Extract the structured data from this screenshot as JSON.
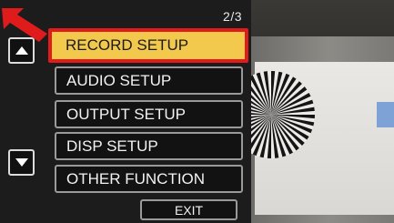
{
  "menu": {
    "page_indicator": "2/3",
    "items": [
      {
        "label": "RECORD SETUP",
        "selected": true
      },
      {
        "label": "AUDIO SETUP",
        "selected": false
      },
      {
        "label": "OUTPUT SETUP",
        "selected": false
      },
      {
        "label": "DISP SETUP",
        "selected": false
      },
      {
        "label": "OTHER FUNCTION",
        "selected": false
      }
    ],
    "exit_label": "EXIT",
    "scroll_up_icon": "up-arrow-icon",
    "scroll_down_icon": "down-arrow-icon"
  },
  "annotation": {
    "icon": "pointer-arrow-icon",
    "color": "#e01b1b"
  },
  "colors": {
    "selected_fill": "#f2c94c",
    "selected_border": "#e01b1b",
    "menu_background": "#1c1c1c",
    "item_border": "#9a9a9a"
  },
  "live_view": {
    "subject": "siemens-star-test-chart",
    "marker_color": "#7fa2d6"
  }
}
